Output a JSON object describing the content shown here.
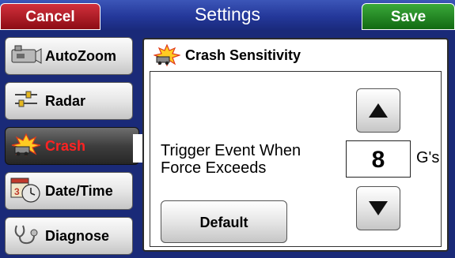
{
  "header": {
    "title": "Settings",
    "cancel_label": "Cancel",
    "save_label": "Save"
  },
  "sidebar": {
    "items": [
      {
        "label": "AutoZoom",
        "icon": "camera-icon",
        "active": false
      },
      {
        "label": "Radar",
        "icon": "radar-icon",
        "active": false
      },
      {
        "label": "Crash",
        "icon": "crash-icon",
        "active": true
      },
      {
        "label": "Date/Time",
        "icon": "calendar-clock-icon",
        "active": false
      },
      {
        "label": "Diagnose",
        "icon": "stethoscope-icon",
        "active": false
      }
    ]
  },
  "panel": {
    "title": "Crash Sensitivity",
    "icon": "crash-icon",
    "trigger_line1": "Trigger Event When",
    "trigger_line2": "Force Exceeds",
    "value": "8",
    "unit": "G's",
    "default_label": "Default",
    "up_icon": "arrow-up-icon",
    "down_icon": "arrow-down-icon"
  },
  "colors": {
    "background": "#1a2a78",
    "header": "#24389a",
    "cancel": "#b01c26",
    "save": "#1f8a1f",
    "active_text": "#ff2222"
  }
}
